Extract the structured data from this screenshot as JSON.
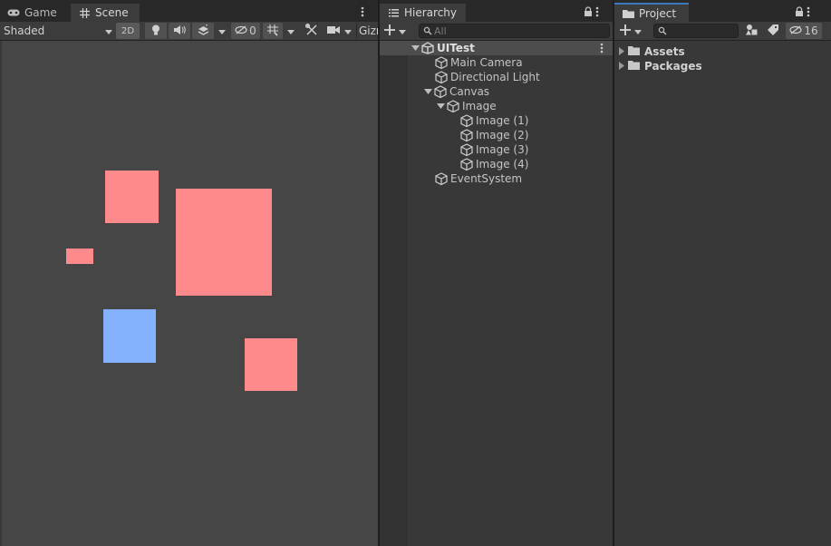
{
  "scene_window": {
    "tabs": [
      {
        "label": "Game",
        "icon": "gamepad-icon"
      },
      {
        "label": "Scene",
        "icon": "grid-icon"
      }
    ],
    "toolbar": {
      "shading_mode": "Shaded",
      "mode_2d_label": "2D",
      "hidden_count": "0",
      "gizmos_label": "Gizmos"
    },
    "objects": [
      {
        "name": "pink-rect-small",
        "color": "#ff8a8c"
      },
      {
        "name": "pink-rect-large",
        "color": "#ff8a8c"
      },
      {
        "name": "pink-rect-tiny",
        "color": "#ff8a8c"
      },
      {
        "name": "blue-rect",
        "color": "#85b2ff"
      },
      {
        "name": "pink-rect-bottom",
        "color": "#ff8a8c"
      }
    ]
  },
  "hierarchy": {
    "tab_label": "Hierarchy",
    "search_placeholder": "All",
    "scene_name": "UITest",
    "items": [
      {
        "label": "Main Camera"
      },
      {
        "label": "Directional Light"
      },
      {
        "label": "Canvas"
      },
      {
        "label": "Image"
      },
      {
        "label": "Image (1)"
      },
      {
        "label": "Image (2)"
      },
      {
        "label": "Image (3)"
      },
      {
        "label": "Image (4)"
      },
      {
        "label": "EventSystem"
      }
    ]
  },
  "project": {
    "tab_label": "Project",
    "hidden_count": "16",
    "folders": [
      {
        "label": "Assets"
      },
      {
        "label": "Packages"
      }
    ]
  },
  "colors": {
    "accent_tab_underline": "#3a79bb",
    "panel_bg": "#383838",
    "scene_bg": "#464646"
  }
}
